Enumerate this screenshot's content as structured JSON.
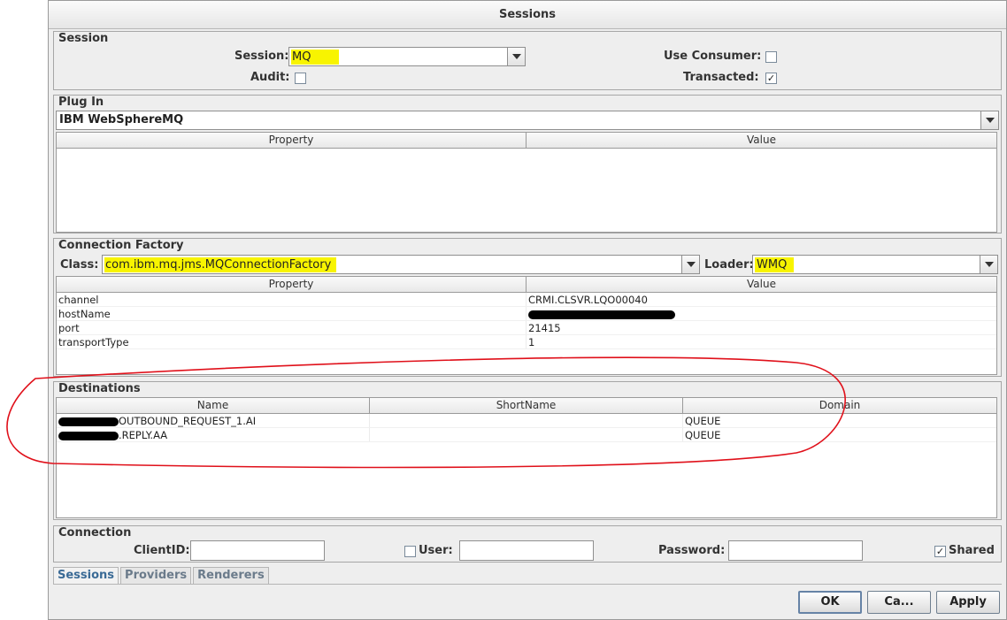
{
  "window": {
    "title": "Sessions"
  },
  "session": {
    "section_title": "Session",
    "session_label": "Session:",
    "session_value": "MQ",
    "use_consumer_label": "Use Consumer:",
    "use_consumer_checked": "",
    "audit_label": "Audit:",
    "audit_checked": "",
    "transacted_label": "Transacted:",
    "transacted_checked": "✓"
  },
  "plugin": {
    "section_title": "Plug In",
    "selected": "IBM WebSphereMQ",
    "columns": [
      "Property",
      "Value"
    ]
  },
  "connection_factory": {
    "section_title": "Connection Factory",
    "class_label": "Class:",
    "class_value": "com.ibm.mq.jms.MQConnectionFactory",
    "loader_label": "Loader:",
    "loader_value": "WMQ",
    "columns": [
      "Property",
      "Value"
    ],
    "rows": [
      {
        "property": "channel",
        "value": "CRMI.CLSVR.LQO00040",
        "redacted": false
      },
      {
        "property": "hostName",
        "value": "",
        "redacted": true
      },
      {
        "property": "port",
        "value": "21415",
        "redacted": false
      },
      {
        "property": "transportType",
        "value": "1",
        "redacted": false
      }
    ]
  },
  "destinations": {
    "section_title": "Destinations",
    "columns": [
      "Name",
      "ShortName",
      "Domain"
    ],
    "rows": [
      {
        "name": "OUTBOUND_REQUEST_1.AI",
        "short_name": "",
        "domain": "QUEUE"
      },
      {
        "name": ".REPLY.AA",
        "short_name": "",
        "domain": "QUEUE"
      }
    ]
  },
  "connection": {
    "section_title": "Connection",
    "client_id_label": "ClientID:",
    "client_id_value": "",
    "user_label": "User:",
    "user_checked": "",
    "user_value": "",
    "password_label": "Password:",
    "password_value": "",
    "shared_label": "Shared",
    "shared_checked": "✓"
  },
  "tabs": [
    "Sessions",
    "Providers",
    "Renderers"
  ],
  "buttons": {
    "ok": "OK",
    "cancel": "Ca...",
    "apply": "Apply"
  },
  "colors": {
    "highlight": "#f8f400",
    "annotation": "#e0101a",
    "default_button_border": "#6683a6"
  }
}
